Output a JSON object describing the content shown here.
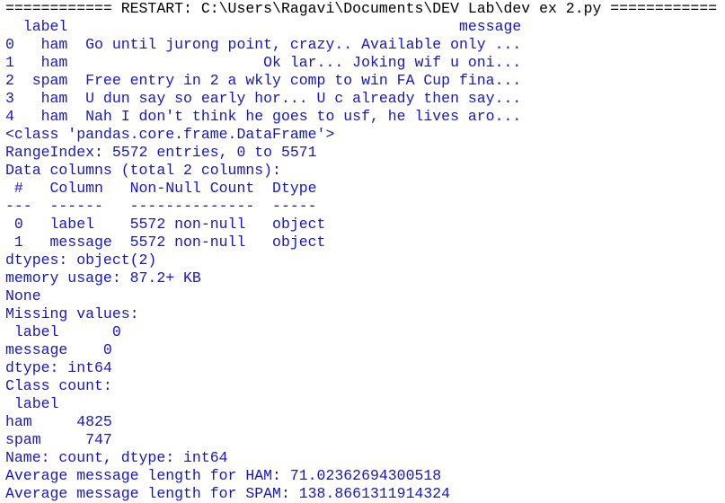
{
  "shell": {
    "restart_line": "============ RESTART: C:\\Users\\Ragavi\\Documents\\DEV Lab\\dev ex 2.py ============",
    "output_lines": [
      "  label                                            message",
      "0   ham  Go until jurong point, crazy.. Available only ...",
      "1   ham                      Ok lar... Joking wif u oni...",
      "2  spam  Free entry in 2 a wkly comp to win FA Cup fina...",
      "3   ham  U dun say so early hor... U c already then say...",
      "4   ham  Nah I don't think he goes to usf, he lives aro...",
      "<class 'pandas.core.frame.DataFrame'>",
      "RangeIndex: 5572 entries, 0 to 5571",
      "Data columns (total 2 columns):",
      " #   Column   Non-Null Count  Dtype",
      "---  ------   --------------  -----",
      " 0   label    5572 non-null   object",
      " 1   message  5572 non-null   object",
      "dtypes: object(2)",
      "memory usage: 87.2+ KB",
      "None",
      "Missing values:",
      " label      0",
      "message    0",
      "dtype: int64",
      "Class count:",
      " label",
      "ham     4825",
      "spam     747",
      "Name: count, dtype: int64",
      "Average message length for HAM: 71.02362694300518",
      "Average message length for SPAM: 138.8661311914324"
    ]
  },
  "colors": {
    "background": "#ffffff",
    "restart_text": "#000000",
    "output_text": "#1515c8"
  }
}
